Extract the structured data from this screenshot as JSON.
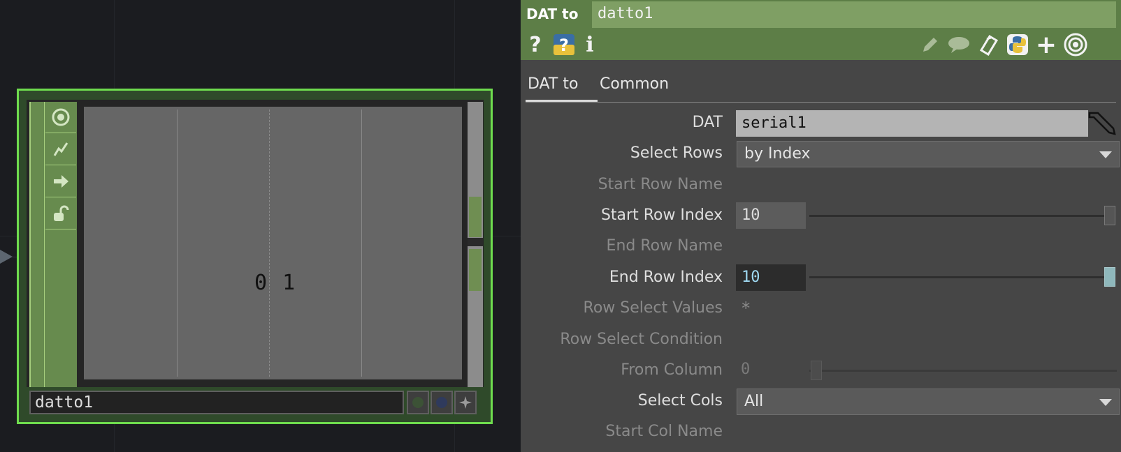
{
  "node": {
    "name": "datto1",
    "viewer_text": "0 1"
  },
  "params": {
    "op_type": "DAT to",
    "op_name": "datto1",
    "header_icons": [
      "help-icon",
      "python-help-icon",
      "info-icon",
      "edit-icon",
      "comment-icon",
      "clipboard-icon",
      "python-icon",
      "add-icon",
      "viewer-icon"
    ],
    "tabs": [
      {
        "label": "DAT to",
        "active": true
      },
      {
        "label": "Common",
        "active": false
      }
    ],
    "dat": {
      "label": "DAT",
      "value": "serial1"
    },
    "select_rows": {
      "label": "Select Rows",
      "value": "by Index"
    },
    "start_row_name": {
      "label": "Start Row Name"
    },
    "start_row_index": {
      "label": "Start Row Index",
      "value": "10"
    },
    "end_row_name": {
      "label": "End Row  Name"
    },
    "end_row_index": {
      "label": "End Row Index",
      "value": "10"
    },
    "row_select_values": {
      "label": "Row Select Values",
      "value": "*"
    },
    "row_select_condition": {
      "label": "Row Select Condition"
    },
    "from_column": {
      "label": "From Column",
      "value": "0"
    },
    "select_cols": {
      "label": "Select Cols",
      "value": "All"
    },
    "start_col_name": {
      "label": "Start Col Name"
    }
  },
  "colors": {
    "node_border": "#6fdc4e",
    "header_bg": "#5d7e47",
    "accent_value": "#9fd9f2"
  }
}
